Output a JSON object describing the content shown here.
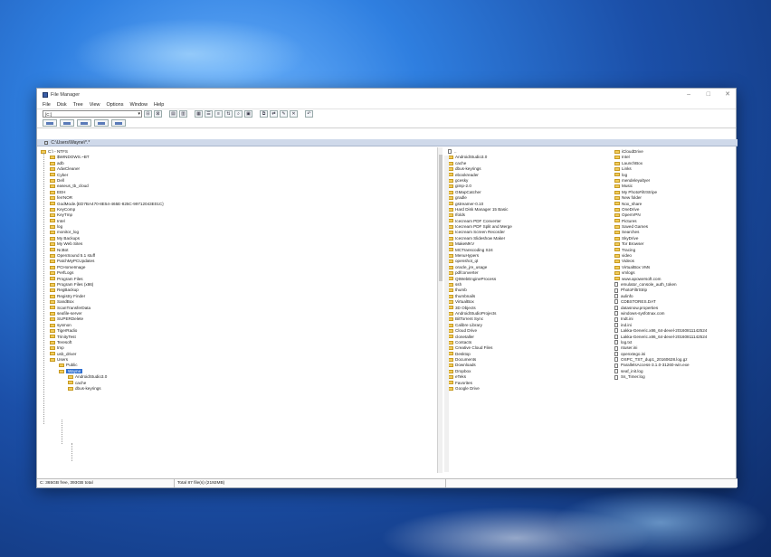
{
  "window": {
    "title": "File Manager",
    "controls": {
      "minimize": "–",
      "maximize": "□",
      "close": "✕"
    }
  },
  "menu": [
    "File",
    "Disk",
    "Tree",
    "View",
    "Options",
    "Window",
    "Help"
  ],
  "toolbar": {
    "drive": "[C:]"
  },
  "path": "C:\\Users\\Wayne\\*.*",
  "tree": [
    {
      "label": "C:\\ - NTFS",
      "depth": 0
    },
    {
      "label": "$WINDOWS.~BT",
      "depth": 1
    },
    {
      "label": "adb",
      "depth": 1
    },
    {
      "label": "AdwCleaner",
      "depth": 1
    },
    {
      "label": "Cyber",
      "depth": 1
    },
    {
      "label": "Dell",
      "depth": 1
    },
    {
      "label": "easeus_tb_cloud",
      "depth": 1
    },
    {
      "label": "EEH",
      "depth": 1
    },
    {
      "label": "ferrNOR",
      "depth": 1
    },
    {
      "label": "GodMode.{ED7BA470-8E54-465E-825C-99712043E01C}",
      "depth": 1
    },
    {
      "label": "KeyComp",
      "depth": 1
    },
    {
      "label": "KeyTmp",
      "depth": 1
    },
    {
      "label": "Intel",
      "depth": 1
    },
    {
      "label": "log",
      "depth": 1
    },
    {
      "label": "monitor_log",
      "depth": 1
    },
    {
      "label": "My Backups",
      "depth": 1
    },
    {
      "label": "My Web Sites",
      "depth": 1
    },
    {
      "label": "NcBot",
      "depth": 1
    },
    {
      "label": "OpenSound 5.1 stuff",
      "depth": 1
    },
    {
      "label": "PatchMyPCUpdates",
      "depth": 1
    },
    {
      "label": "PCHomeImage",
      "depth": 1
    },
    {
      "label": "PerfLogs",
      "depth": 1
    },
    {
      "label": "Program Files",
      "depth": 1
    },
    {
      "label": "Program Files (x86)",
      "depth": 1
    },
    {
      "label": "RegBackup",
      "depth": 1
    },
    {
      "label": "Registry Finder",
      "depth": 1
    },
    {
      "label": "SandBox",
      "depth": 1
    },
    {
      "label": "ScanTransferData",
      "depth": 1
    },
    {
      "label": "seafile-server",
      "depth": 1
    },
    {
      "label": "SUPERDelete",
      "depth": 1
    },
    {
      "label": "sysmon",
      "depth": 1
    },
    {
      "label": "TigerRadio",
      "depth": 1
    },
    {
      "label": "TrinityTest",
      "depth": 1
    },
    {
      "label": "Teresoft",
      "depth": 1
    },
    {
      "label": "tmp",
      "depth": 1
    },
    {
      "label": "usb_driver",
      "depth": 1
    },
    {
      "label": "Users",
      "depth": 1
    },
    {
      "label": "Public",
      "depth": 2
    },
    {
      "label": "Wayne",
      "depth": 2,
      "selected": true
    },
    {
      "label": "AndroidStudio3.0",
      "depth": 3
    },
    {
      "label": "cache",
      "depth": 3
    },
    {
      "label": "dbus-keyrings",
      "depth": 3
    }
  ],
  "files_col1": [
    {
      "name": "..",
      "type": "up"
    },
    {
      "name": "AndroidStudio3.0",
      "type": "folder"
    },
    {
      "name": "cache",
      "type": "folder"
    },
    {
      "name": "dbus-keyrings",
      "type": "folder"
    },
    {
      "name": "ebookreader",
      "type": "folder"
    },
    {
      "name": "gcesky",
      "type": "folder"
    },
    {
      "name": "gimp-2.0",
      "type": "folder"
    },
    {
      "name": "GMapCatcher",
      "type": "folder"
    },
    {
      "name": "gradle",
      "type": "folder"
    },
    {
      "name": "gstreamer-0.10",
      "type": "folder"
    },
    {
      "name": "Hard Disk Manager 15 Basic",
      "type": "folder"
    },
    {
      "name": "Ifolds",
      "type": "folder"
    },
    {
      "name": "Icecream PDF Converter",
      "type": "folder"
    },
    {
      "name": "Icecream PDF Split and Merge",
      "type": "folder"
    },
    {
      "name": "Icecream Screen Recorder",
      "type": "folder"
    },
    {
      "name": "Icecream Slideshow Maker",
      "type": "folder"
    },
    {
      "name": "MakeMKV",
      "type": "folder"
    },
    {
      "name": "MCTranscoding S24",
      "type": "folder"
    },
    {
      "name": "MenuHypers",
      "type": "folder"
    },
    {
      "name": "openshot_qt",
      "type": "folder"
    },
    {
      "name": "oracle_jre_usage",
      "type": "folder"
    },
    {
      "name": "pdfconverter",
      "type": "folder"
    },
    {
      "name": "QtWebEngineProcess",
      "type": "folder"
    },
    {
      "name": "ssh",
      "type": "folder"
    },
    {
      "name": "thumb",
      "type": "folder"
    },
    {
      "name": "thumbnails",
      "type": "folder"
    },
    {
      "name": "VirtualBox",
      "type": "folder"
    },
    {
      "name": "3D Objects",
      "type": "folder"
    },
    {
      "name": "AndroidStudioProjects",
      "type": "folder"
    },
    {
      "name": "BitTorrent Sync",
      "type": "folder"
    },
    {
      "name": "Calibre Library",
      "type": "folder"
    },
    {
      "name": "Cloud Drive",
      "type": "folder"
    },
    {
      "name": "clonetaller",
      "type": "folder"
    },
    {
      "name": "Contacts",
      "type": "folder"
    },
    {
      "name": "Creative Cloud Files",
      "type": "folder"
    },
    {
      "name": "Desktop",
      "type": "folder"
    },
    {
      "name": "Documents",
      "type": "folder"
    },
    {
      "name": "Downloads",
      "type": "folder"
    },
    {
      "name": "Dropbox",
      "type": "folder"
    },
    {
      "name": "eTeks",
      "type": "folder"
    },
    {
      "name": "Favorites",
      "type": "folder"
    },
    {
      "name": "Google Drive",
      "type": "folder"
    }
  ],
  "files_col2": [
    {
      "name": "iCloudDrive",
      "type": "folder"
    },
    {
      "name": "Intel",
      "type": "folder"
    },
    {
      "name": "LaunchBox",
      "type": "folder"
    },
    {
      "name": "Links",
      "type": "folder"
    },
    {
      "name": "log",
      "type": "folder"
    },
    {
      "name": "mendeleyaltyer",
      "type": "folder"
    },
    {
      "name": "Music",
      "type": "folder"
    },
    {
      "name": "My PhotoFiltrStripe",
      "type": "folder"
    },
    {
      "name": "New folder",
      "type": "folder"
    },
    {
      "name": "Nox_share",
      "type": "folder"
    },
    {
      "name": "OneDrive",
      "type": "folder"
    },
    {
      "name": "OpenVPN",
      "type": "folder"
    },
    {
      "name": "Pictures",
      "type": "folder"
    },
    {
      "name": "Saved Games",
      "type": "folder"
    },
    {
      "name": "Searches",
      "type": "folder"
    },
    {
      "name": "SkyDrive",
      "type": "folder"
    },
    {
      "name": "Tor Browser",
      "type": "folder"
    },
    {
      "name": "Tracing",
      "type": "folder"
    },
    {
      "name": "video",
      "type": "folder"
    },
    {
      "name": "Videos",
      "type": "folder"
    },
    {
      "name": "VirtualBox VMs",
      "type": "folder"
    },
    {
      "name": "vmlogs",
      "type": "folder"
    },
    {
      "name": "www.apowersoft.com",
      "type": "folder"
    },
    {
      "name": "emulator_console_auth_token",
      "type": "file"
    },
    {
      "name": "PhotoFiltrStrip",
      "type": "file"
    },
    {
      "name": "aulinfo",
      "type": "file"
    },
    {
      "name": "CDBSTORES.DAT",
      "type": "file"
    },
    {
      "name": "datasnow.properties",
      "type": "file"
    },
    {
      "name": "windows-sysfotnax.com",
      "type": "file"
    },
    {
      "name": "Indt.ini",
      "type": "file"
    },
    {
      "name": "ind.ini",
      "type": "file"
    },
    {
      "name": "Lakka-Generic.x86_64-devel-20160811142524",
      "type": "file"
    },
    {
      "name": "Lakka-Generic.x86_64-devel-20160811142524",
      "type": "file"
    },
    {
      "name": "log.txt",
      "type": "file"
    },
    {
      "name": "ntuser.ini",
      "type": "file"
    },
    {
      "name": "openxtego.ini",
      "type": "file"
    },
    {
      "name": "OSPC_TST_dup1_20160628.log.gz",
      "type": "file"
    },
    {
      "name": "ParallelsAccess-3.1.0-31260-win.exe",
      "type": "file"
    },
    {
      "name": "seaf_init.log",
      "type": "file"
    },
    {
      "name": "Ss_Timer.log",
      "type": "file"
    }
  ],
  "status": {
    "disk": "C: 365GB free, 393GB total",
    "selection": "Total 87 file(s) (2192MB)"
  }
}
